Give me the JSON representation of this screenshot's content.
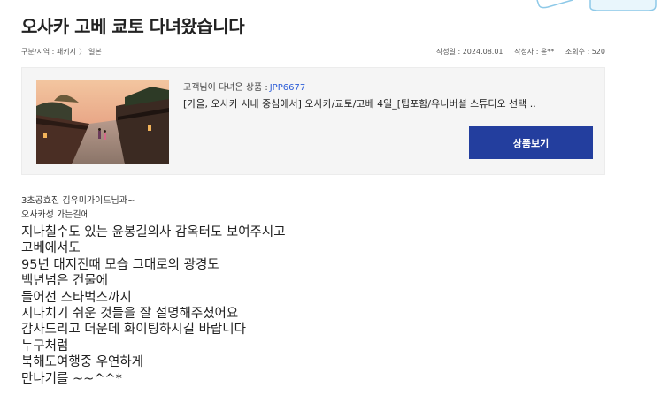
{
  "post": {
    "title": "오사카 고베 쿄토 다녀왔습니다",
    "breadcrumb": [
      "구분/지역 : 패키지",
      "일본"
    ],
    "date_label": "작성일 : 2024.08.01",
    "author_label": "작성자 : 윤**",
    "views_label": "조회수 : 520"
  },
  "product": {
    "label": "고객님이 다녀온 상품 :",
    "code": "JPP6677",
    "name": "[가을, 오사카 시내 중심에서] 오사카/교토/고베 4일_[팁포함/유니버셜 스튜디오 선택 ..",
    "button_label": "상품보기",
    "image_alt": "kyoto-street-photo"
  },
  "content": {
    "small_lines": [
      "3초공효진 김유미가이드님과~",
      "오사카성 가는길에"
    ],
    "large_lines": [
      "지나칠수도 있는 윤봉길의사 감옥터도 보여주시고",
      "고베에서도",
      "95년 대지진때 모습 그대로의 광경도",
      "백년넘은 건물에",
      "들어선 스타벅스까지",
      "지나치기 쉬운 것들을 잘 설명해주셨어요",
      "감사드리고 더운데 화이팅하시길 바랍니다",
      "누구처럼",
      "북해도여행중 우연하게",
      "만나기를 ~~^^*"
    ]
  },
  "colors": {
    "accent_button": "#233e9e",
    "product_code": "#2a5bd7",
    "card_background": "#f5f5f5"
  }
}
